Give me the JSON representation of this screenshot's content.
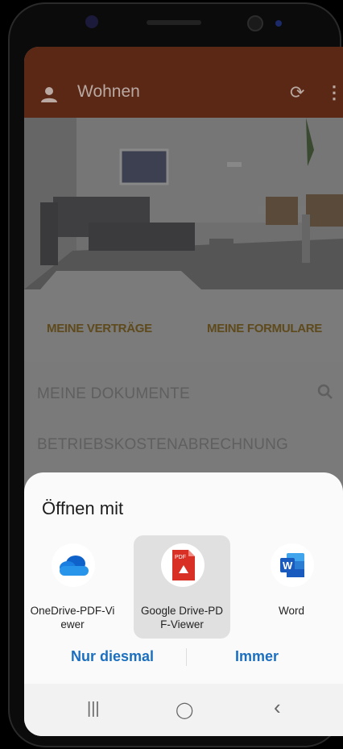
{
  "appbar": {
    "title": "Wohnen",
    "user_icon": "person-icon",
    "refresh_glyph": "⟳",
    "more_glyph": "⋮",
    "bg_color": "#5a2814"
  },
  "tabs": [
    "MEINE VERTRÄGE",
    "MEINE FORMULARE"
  ],
  "sections": [
    "MEINE DOKUMENTE",
    "BETRIEBSKOSTENABRECHNUNG"
  ],
  "search_glyph": "⚲",
  "sheet": {
    "title": "Öffnen mit",
    "apps": [
      {
        "label": "OneDrive-PDF-Vi\newer",
        "icon": "onedrive-icon",
        "selected": false
      },
      {
        "label": "Google Drive-PD\nF-Viewer",
        "icon": "pdf-icon",
        "selected": true
      },
      {
        "label": "Word",
        "icon": "word-icon",
        "selected": false
      }
    ],
    "buttons": {
      "once": "Nur diesmal",
      "always": "Immer"
    }
  },
  "navbar": {
    "recents": "|||",
    "home": "◯",
    "back": "‹"
  },
  "pdf_badge": "PDF",
  "word_badge": "W"
}
